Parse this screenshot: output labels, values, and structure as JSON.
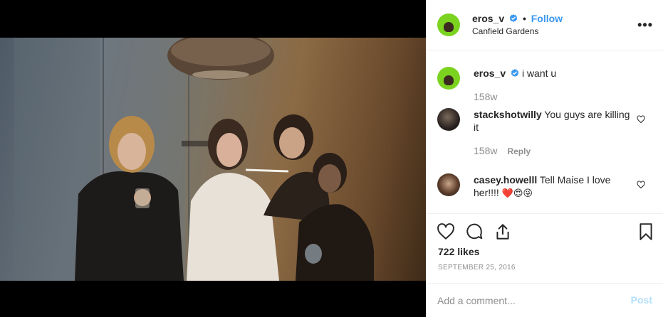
{
  "post": {
    "author": "eros_v",
    "location": "Canfield Gardens",
    "follow_label": "Follow",
    "dot": "•",
    "more_label": "•••"
  },
  "caption": {
    "author": "eros_v",
    "text": "i want u",
    "time": "158w"
  },
  "comments": [
    {
      "author": "stackshotwilly",
      "text": "You guys are killing it",
      "time": "158w",
      "reply_label": "Reply"
    },
    {
      "author": "casey.howelll",
      "text": "Tell Maise I love her!!!! ",
      "emojis": "❤️😍😜"
    }
  ],
  "stats": {
    "likes": "722 likes",
    "date": "SEPTEMBER 25, 2016"
  },
  "composer": {
    "placeholder": "Add a comment...",
    "post_label": "Post"
  },
  "colors": {
    "link_blue": "#3897f0",
    "verified_blue": "#3897f0",
    "post_disabled": "#b2dffc",
    "avatar_green": "#7bd320"
  },
  "icons": {
    "verified": "verified-badge-icon",
    "heart": "heart-icon",
    "comment": "comment-icon",
    "share": "share-icon",
    "save": "bookmark-icon",
    "more": "more-options-icon"
  }
}
